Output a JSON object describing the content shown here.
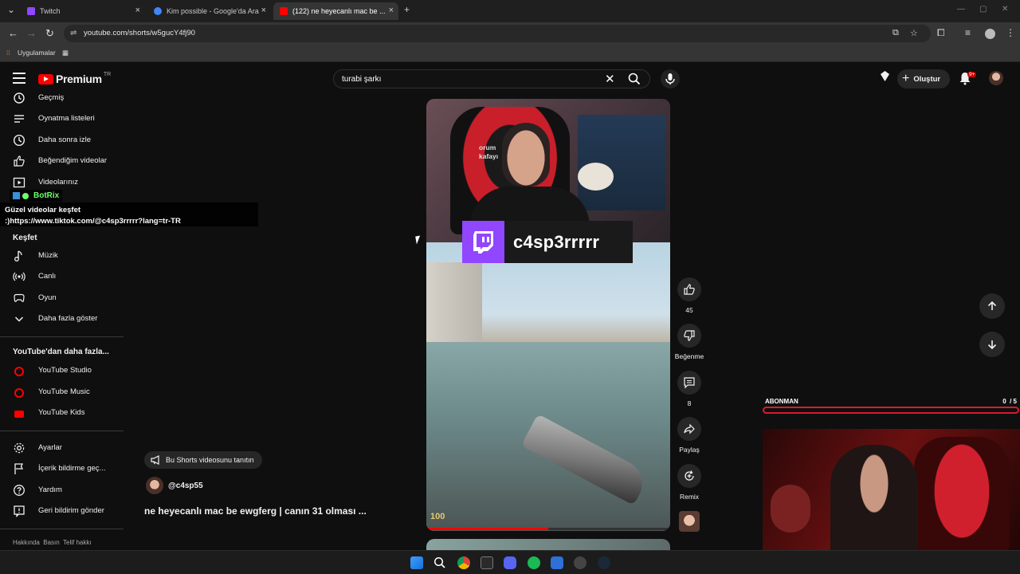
{
  "browser": {
    "tabs": [
      {
        "title": "Twitch",
        "color": "#9146ff"
      },
      {
        "title": "Kim possible - Google'da Ara",
        "color": "#4285f4"
      },
      {
        "title": "(122) ne heyecanlı mac be ...",
        "color": "#ff0000"
      }
    ],
    "url": "youtube.com/shorts/w5gucY4fj90",
    "bookmark": "Uygulamalar"
  },
  "header": {
    "brand": "Premium",
    "region": "TR",
    "search_query": "turabi şarkı",
    "create_label": "Oluştur",
    "notif_badge": "9+"
  },
  "sidebar": {
    "top_items": [
      {
        "label": "Geçmiş",
        "icon": "history-icon"
      },
      {
        "label": "Oynatma listeleri",
        "icon": "playlist-icon"
      },
      {
        "label": "Daha sonra izle",
        "icon": "clock-icon"
      },
      {
        "label": "Beğendiğim videolar",
        "icon": "like-icon"
      },
      {
        "label": "Videolarınız",
        "icon": "video-icon"
      }
    ],
    "explore_heading": "Keşfet",
    "explore_items": [
      {
        "label": "Müzik",
        "icon": "music-icon"
      },
      {
        "label": "Canlı",
        "icon": "live-icon"
      },
      {
        "label": "Oyun",
        "icon": "gaming-icon"
      },
      {
        "label": "Daha fazla göster",
        "icon": "chevron-down-icon"
      }
    ],
    "more_heading": "YouTube'dan daha fazla...",
    "more_items": [
      {
        "label": "YouTube Studio"
      },
      {
        "label": "YouTube Music"
      },
      {
        "label": "YouTube Kids"
      }
    ],
    "settings_items": [
      {
        "label": "Ayarlar",
        "icon": "gear-icon"
      },
      {
        "label": "İçerik bildirme geç...",
        "icon": "flag-icon"
      },
      {
        "label": "Yardım",
        "icon": "help-icon"
      },
      {
        "label": "Geri bildirim gönder",
        "icon": "feedback-icon"
      }
    ],
    "footer": "Hakkında  Basın  Telif hakkı"
  },
  "botrix": {
    "name": "BotRix",
    "line1": "Güzel videolar keşfet",
    "line2": ":)https://www.tiktok.com/@c4sp3rrrrr?lang=tr-TR"
  },
  "short": {
    "overlay_text": "orum kafayı",
    "twitch_name": "c4sp3rrrrr",
    "hud_hp": "100",
    "progress": 0.5,
    "promo_label": "Bu Shorts videosunu tanıtın",
    "channel": "@c4sp55",
    "title": "ne heyecanlı mac be ewgferg | canın 31 olması ..."
  },
  "actions": {
    "likes": "45",
    "dislike_label": "Beğenme",
    "comments": "8",
    "share_label": "Paylaş",
    "remix_label": "Remix"
  },
  "stream_overlay": {
    "goal_label": "ABONMAN",
    "goal_count": "0  / 5"
  }
}
